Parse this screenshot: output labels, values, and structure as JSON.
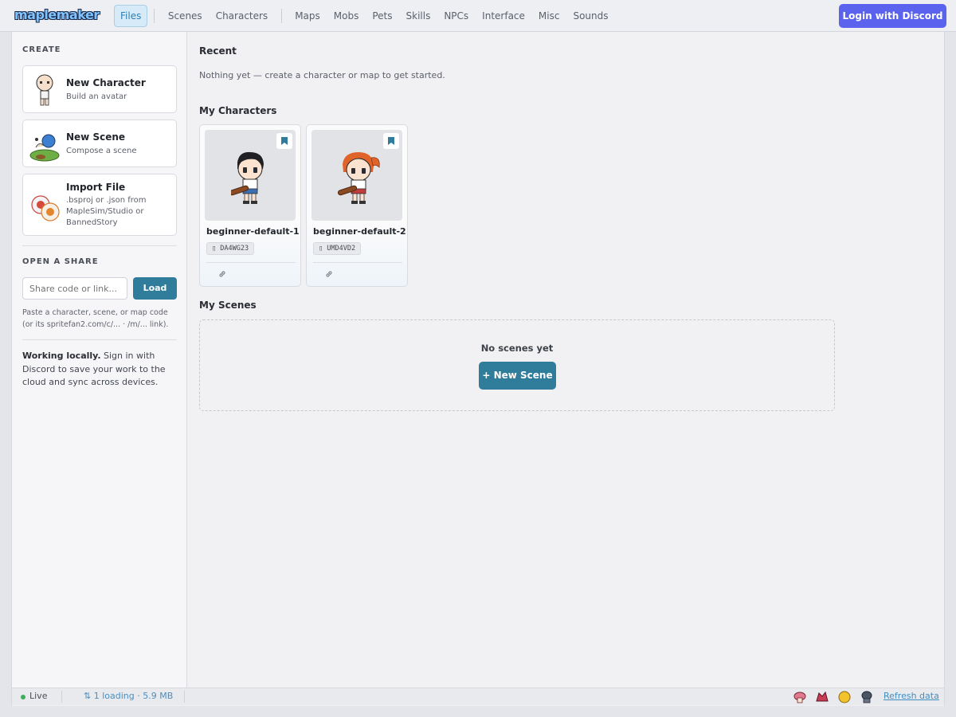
{
  "app": {
    "logo": "maplemaker"
  },
  "nav": {
    "items": [
      {
        "label": "Files",
        "active": true
      },
      {
        "label": "Scenes"
      },
      {
        "label": "Characters"
      },
      {
        "label": "Maps"
      },
      {
        "label": "Mobs"
      },
      {
        "label": "Pets"
      },
      {
        "label": "Skills"
      },
      {
        "label": "NPCs"
      },
      {
        "label": "Interface"
      },
      {
        "label": "Misc"
      },
      {
        "label": "Sounds"
      }
    ],
    "login_label": "Login with Discord"
  },
  "sidebar": {
    "create_heading": "CREATE",
    "create_items": [
      {
        "title": "New Character",
        "subtitle": "Build an avatar"
      },
      {
        "title": "New Scene",
        "subtitle": "Compose a scene"
      },
      {
        "title": "Import File",
        "subtitle": ".bsproj or .json from MapleSim/Studio or BannedStory"
      }
    ],
    "share_heading": "OPEN A SHARE",
    "share_placeholder": "Share code or link...",
    "load_label": "Load",
    "share_hint": "Paste a character, scene, or map code (or its spritefan2.com/c/... · /m/... link).",
    "local_strong": "Working locally.",
    "local_text": " Sign in with Discord to save your work to the cloud and sync across devices."
  },
  "main": {
    "recent_title": "Recent",
    "recent_empty": "Nothing yet — create a character or map to get started.",
    "characters_title": "My Characters",
    "characters": [
      {
        "name": "beginner-default-1",
        "code": "DA4WG23"
      },
      {
        "name": "beginner-default-2",
        "code": "UMD4VD2"
      }
    ],
    "scenes_title": "My Scenes",
    "scenes_empty": "No scenes yet",
    "new_scene_label": "+ New Scene"
  },
  "status": {
    "live": "Live",
    "loading": "⇅  1 loading · 5.9 MB",
    "refresh": "Refresh data"
  },
  "colors": {
    "accent": "#2f7d9b",
    "discord": "#5b63ee",
    "live": "#3cae5a",
    "link": "#3f8ec2"
  }
}
